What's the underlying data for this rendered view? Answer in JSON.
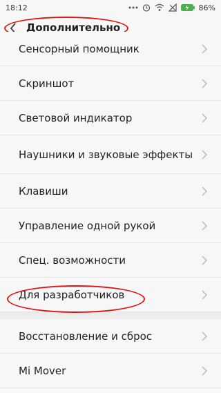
{
  "status": {
    "time": "18:12",
    "battery": "86%"
  },
  "header": {
    "title": "Дополнительно"
  },
  "items": [
    {
      "label": "Сенсорный помощник"
    },
    {
      "label": "Скриншот"
    },
    {
      "label": "Световой индикатор"
    },
    {
      "label": "Наушники и звуковые эффекты"
    },
    {
      "label": "Клавиши"
    },
    {
      "label": "Управление одной рукой"
    },
    {
      "label": "Спец. возможности"
    },
    {
      "label": "Для разработчиков"
    },
    {
      "label": "Восстановление и сброс"
    },
    {
      "label": "Mi Mover"
    }
  ],
  "colors": {
    "annotation": "#e01414",
    "background": "#f7f7f7"
  }
}
